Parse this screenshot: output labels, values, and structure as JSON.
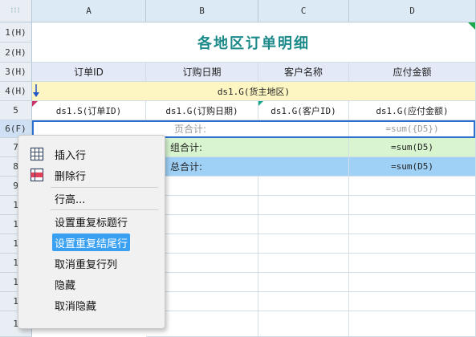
{
  "corner_glyph": "⁝⁝⁝",
  "columns": [
    "A",
    "B",
    "C",
    "D"
  ],
  "rows": [
    "1(H)",
    "2(H)",
    "3(H)",
    "4(H)",
    "5",
    "6(F)",
    "7",
    "8",
    "9",
    "1",
    "1",
    "1",
    "1",
    "1",
    "1",
    "1"
  ],
  "report": {
    "title": "各地区订单明细",
    "headers": [
      "订单ID",
      "订购日期",
      "客户名称",
      "应付金额"
    ],
    "group_field": "ds1.G(货主地区)",
    "detail": [
      "ds1.S(订单ID)",
      "ds1.G(订购日期)",
      "ds1.G(客户ID)",
      "ds1.G(应付金额)"
    ],
    "page_total_label": "页合计:",
    "page_total_formula": "=sum({D5})",
    "group_total_label": "组合计:",
    "group_total_formula": "=sum(D5)",
    "grand_total_label": "总合计:",
    "grand_total_formula": "=sum(D5)"
  },
  "context_menu": {
    "items": [
      {
        "label": "插入行",
        "icon": "insert-row-icon"
      },
      {
        "label": "删除行",
        "icon": "delete-row-icon"
      },
      {
        "label": "行高..."
      },
      {
        "label": "设置重复标题行"
      },
      {
        "label": "设置重复结尾行"
      },
      {
        "label": "取消重复行列"
      },
      {
        "label": "隐藏"
      },
      {
        "label": "取消隐藏"
      }
    ],
    "selected_index": 4
  },
  "colors": {
    "title": "#1d8a8a",
    "selection": "#3aa0f2",
    "group_row": "#fdf6c2",
    "green_row": "#d8f5d0",
    "blue_row": "#9fd0f5"
  }
}
